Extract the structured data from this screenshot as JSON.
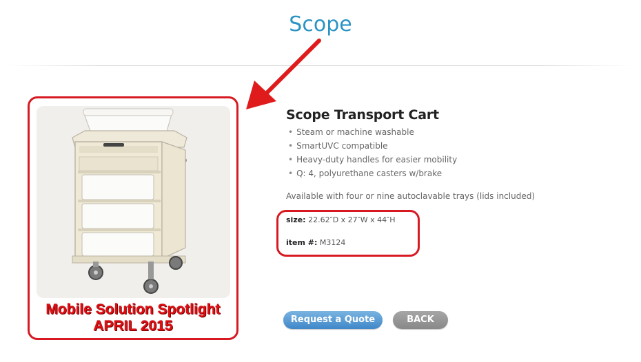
{
  "page": {
    "title": "Scope"
  },
  "product": {
    "name": "Scope Transport Cart",
    "features": [
      "Steam or machine washable",
      "SmartUVC compatible",
      "Heavy-duty handles for easier mobility",
      "Q: 4, polyurethane casters w/brake"
    ],
    "availability": "Available with four or nine autoclavable trays (lids included)",
    "size_label": "size:",
    "size_value": "22.62″D x 27″W x 44″H",
    "item_label": "item #:",
    "item_value": "M3124",
    "image_icon": "transport-cart-image"
  },
  "annotation": {
    "spotlight_line1": "Mobile Solution Spotlight",
    "spotlight_line2": "APRIL 2015",
    "highlight_color": "#d71921",
    "arrow_icon": "arrow-icon"
  },
  "buttons": {
    "quote_label": "Request a Quote",
    "back_label": "BACK"
  },
  "colors": {
    "title": "#2b93c4",
    "quote_button": "#4a8fcd",
    "back_button": "#999999"
  }
}
